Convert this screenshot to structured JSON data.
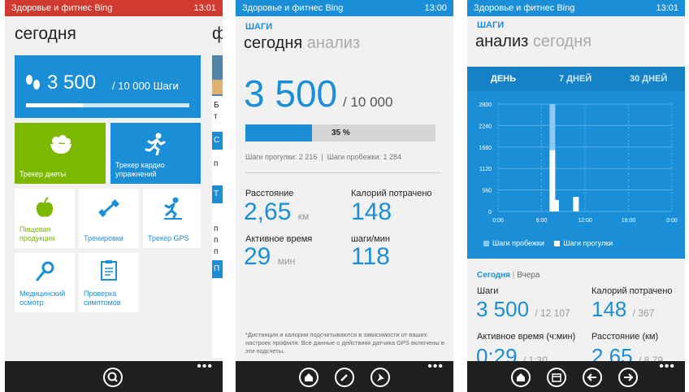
{
  "status": {
    "app_title": "Здоровье и фитнес Bing",
    "time": "13:01",
    "time2": "13:00",
    "time3": "13:01"
  },
  "colors": {
    "status_red": "#d13a2f",
    "status_blue": "#1a8fd8",
    "accent": "#1a8fd8",
    "diet_green": "#7cb800",
    "chart_bg": "#1a8fd8"
  },
  "screen1": {
    "title": "сегодня",
    "peek_title": "ф",
    "steps_tile": {
      "value": "3 500",
      "goal": "/ 10 000 Шаги",
      "progress": 0.35
    },
    "tiles": [
      {
        "label": "Трекер диеты",
        "icon": "salad-icon"
      },
      {
        "label": "Трекер кардио упражнений",
        "icon": "runner-icon"
      },
      {
        "label": "Пищевая продукция",
        "icon": "apple-icon"
      },
      {
        "label": "Тренировки",
        "icon": "dumbbell-icon"
      },
      {
        "label": "Трекер GPS",
        "icon": "gps-runner-icon"
      },
      {
        "label": "Медицинский осмотр",
        "icon": "stethoscope-icon"
      },
      {
        "label": "Проверка симптомов",
        "icon": "clipboard-icon"
      }
    ],
    "peek_texts": [
      "Б",
      "т",
      "С",
      "п",
      "Т",
      "п",
      "п",
      "п",
      "П"
    ],
    "appbar_icon": "search-icon"
  },
  "screen2": {
    "section": "ШАГИ",
    "header_active": "сегодня",
    "header_other": "анализ",
    "steps_value": "3 500",
    "steps_goal": "/ 10 000",
    "progress_percent": "35 %",
    "progress": 0.35,
    "breakdown": "Шаги прогулки: 2 216  |  Шаги пробежки: 1 284",
    "stats": [
      {
        "label": "Расстояние",
        "value": "2,65",
        "unit": "км"
      },
      {
        "label": "Калорий потрачено",
        "value": "148",
        "unit": ""
      },
      {
        "label": "Активное время",
        "value": "29",
        "unit": "мин"
      },
      {
        "label": "шаги/мин",
        "value": "118",
        "unit": ""
      }
    ],
    "footnote": "*Дистанция и калории подсчитываются в зависимости от ваших настроек профиля. Все данные о действиях датчика GPS включены в эти подсчеты.",
    "appbar_icons": [
      "home-icon",
      "edit-icon",
      "pin-icon"
    ]
  },
  "screen3": {
    "section": "ШАГИ",
    "header_active": "анализ",
    "header_other": "сегодня",
    "tabs": [
      "ДЕНЬ",
      "7 ДНЕЙ",
      "30 ДНЕЙ"
    ],
    "legend": [
      "Шаги пробежки",
      "Шаги прогулки"
    ],
    "day_switch": {
      "active": "Сегодня",
      "sep": "|",
      "other": "Вчера"
    },
    "stats": [
      {
        "label": "Шаги",
        "value": "3 500",
        "unit": "/ 12 107"
      },
      {
        "label": "Калорий потрачено",
        "value": "148",
        "unit": "/ 367"
      },
      {
        "label": "Активное время (ч:мин)",
        "value": "0:29",
        "unit": "/ 1:30"
      },
      {
        "label": "Расстояние (км)",
        "value": "2,65",
        "unit": "/ 8,79"
      }
    ],
    "appbar_icons": [
      "home-icon",
      "calendar-icon",
      "back-icon",
      "forward-icon"
    ]
  },
  "chart_data": {
    "type": "bar",
    "x_ticks": [
      "0:00",
      "6:00",
      "12:00",
      "18:00",
      "0:00"
    ],
    "y_ticks": [
      "0",
      "560",
      "1120",
      "1680",
      "2240",
      "2800"
    ],
    "ylim": [
      0,
      2800
    ],
    "x": [
      7.5,
      8.0,
      10.75
    ],
    "series": [
      {
        "name": "Шаги пробежки",
        "values": [
          1200,
          0,
          0
        ]
      },
      {
        "name": "Шаги прогулки",
        "values": [
          1600,
          300,
          380
        ]
      }
    ],
    "legend_position": "bottom-left"
  }
}
